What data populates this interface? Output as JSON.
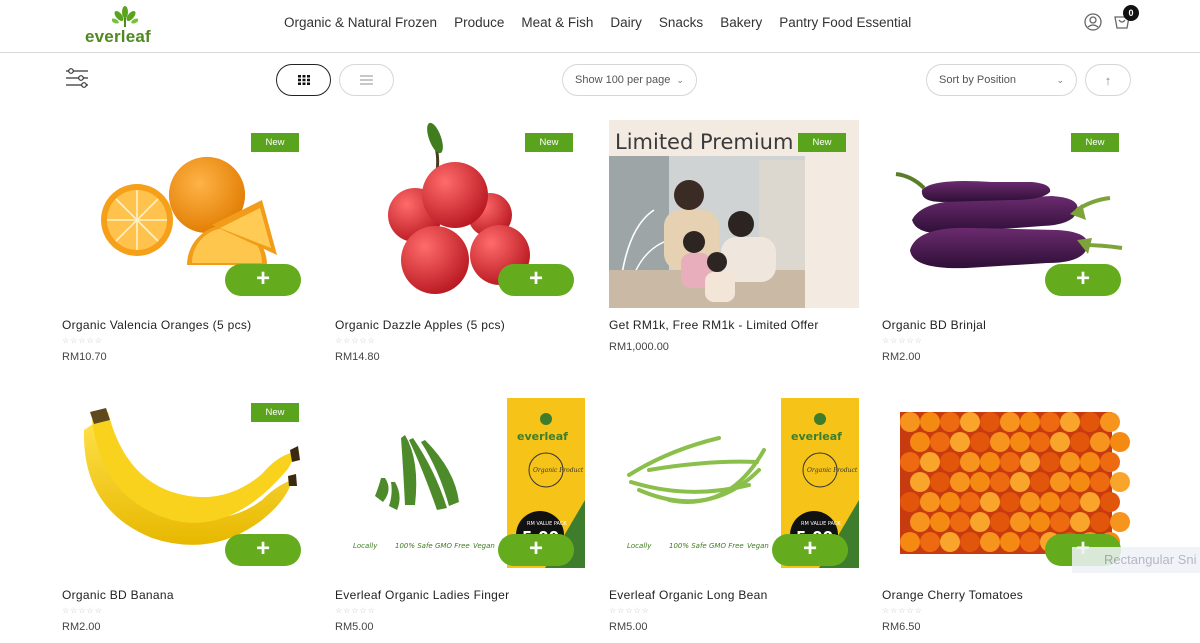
{
  "brand": {
    "name": "everleaf"
  },
  "nav": [
    "Organic & Natural Frozen",
    "Produce",
    "Meat & Fish",
    "Dairy",
    "Snacks",
    "Bakery",
    "Pantry Food Essential"
  ],
  "cart": {
    "count": "0"
  },
  "toolbar": {
    "per_page": "Show 100 per page",
    "sort": "Sort by Position"
  },
  "badge_label": "New",
  "add_label": "+",
  "products": [
    {
      "name": "Organic Valencia Oranges (5 pcs)",
      "price": "RM10.70",
      "new": true
    },
    {
      "name": "Organic Dazzle Apples (5 pcs)",
      "price": "RM14.80",
      "new": true
    },
    {
      "name": "Get RM1k, Free RM1k - Limited Offer",
      "price": "RM1,000.00",
      "new": true,
      "banner_text": "Limited Premium"
    },
    {
      "name": "Organic BD Brinjal",
      "price": "RM2.00",
      "new": true
    },
    {
      "name": "Organic BD Banana",
      "price": "RM2.00",
      "new": true
    },
    {
      "name": "Everleaf Organic Ladies Finger",
      "price": "RM5.00",
      "new": false
    },
    {
      "name": "Everleaf Organic Long Bean",
      "price": "RM5.00",
      "new": false
    },
    {
      "name": "Orange Cherry Tomatoes",
      "price": "RM6.50",
      "new": false
    }
  ],
  "package": {
    "brand": "everleaf",
    "tag": "Organic Product",
    "value_label": "RM VALUE PACK",
    "value": "5.00",
    "footer": [
      "Locally",
      "100% Safe",
      "GMO Free",
      "Vegan"
    ]
  },
  "overlay_text": "Rectangular Sni",
  "colors": {
    "accent": "#64ac1e",
    "badge": "#5aa31d",
    "package_yellow": "#f6c419"
  }
}
